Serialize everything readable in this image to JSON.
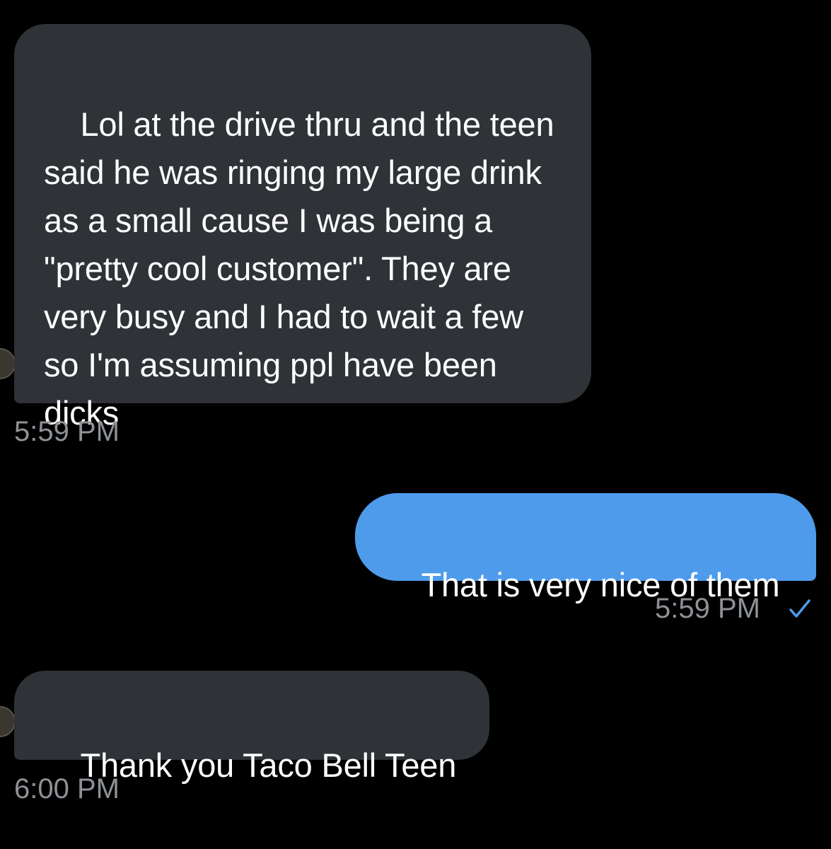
{
  "conversation": {
    "messages": [
      {
        "direction": "incoming",
        "text": "Lol at the drive thru and the teen said he was ringing my large drink as a small cause I was being a \"pretty cool customer\". They are very busy and I had to wait a few  so I'm assuming ppl have been dicks",
        "time": "5:59 PM"
      },
      {
        "direction": "outgoing",
        "text": "That is very nice of them",
        "time": "5:59 PM",
        "status": "sent-check-icon"
      },
      {
        "direction": "incoming",
        "text": "Thank you Taco Bell Teen",
        "time": "6:00 PM"
      }
    ]
  },
  "colors": {
    "background": "#000000",
    "incoming_bubble": "#2f3236",
    "outgoing_bubble": "#4e9bec",
    "timestamp": "#8e9296",
    "check": "#4e9bec"
  }
}
